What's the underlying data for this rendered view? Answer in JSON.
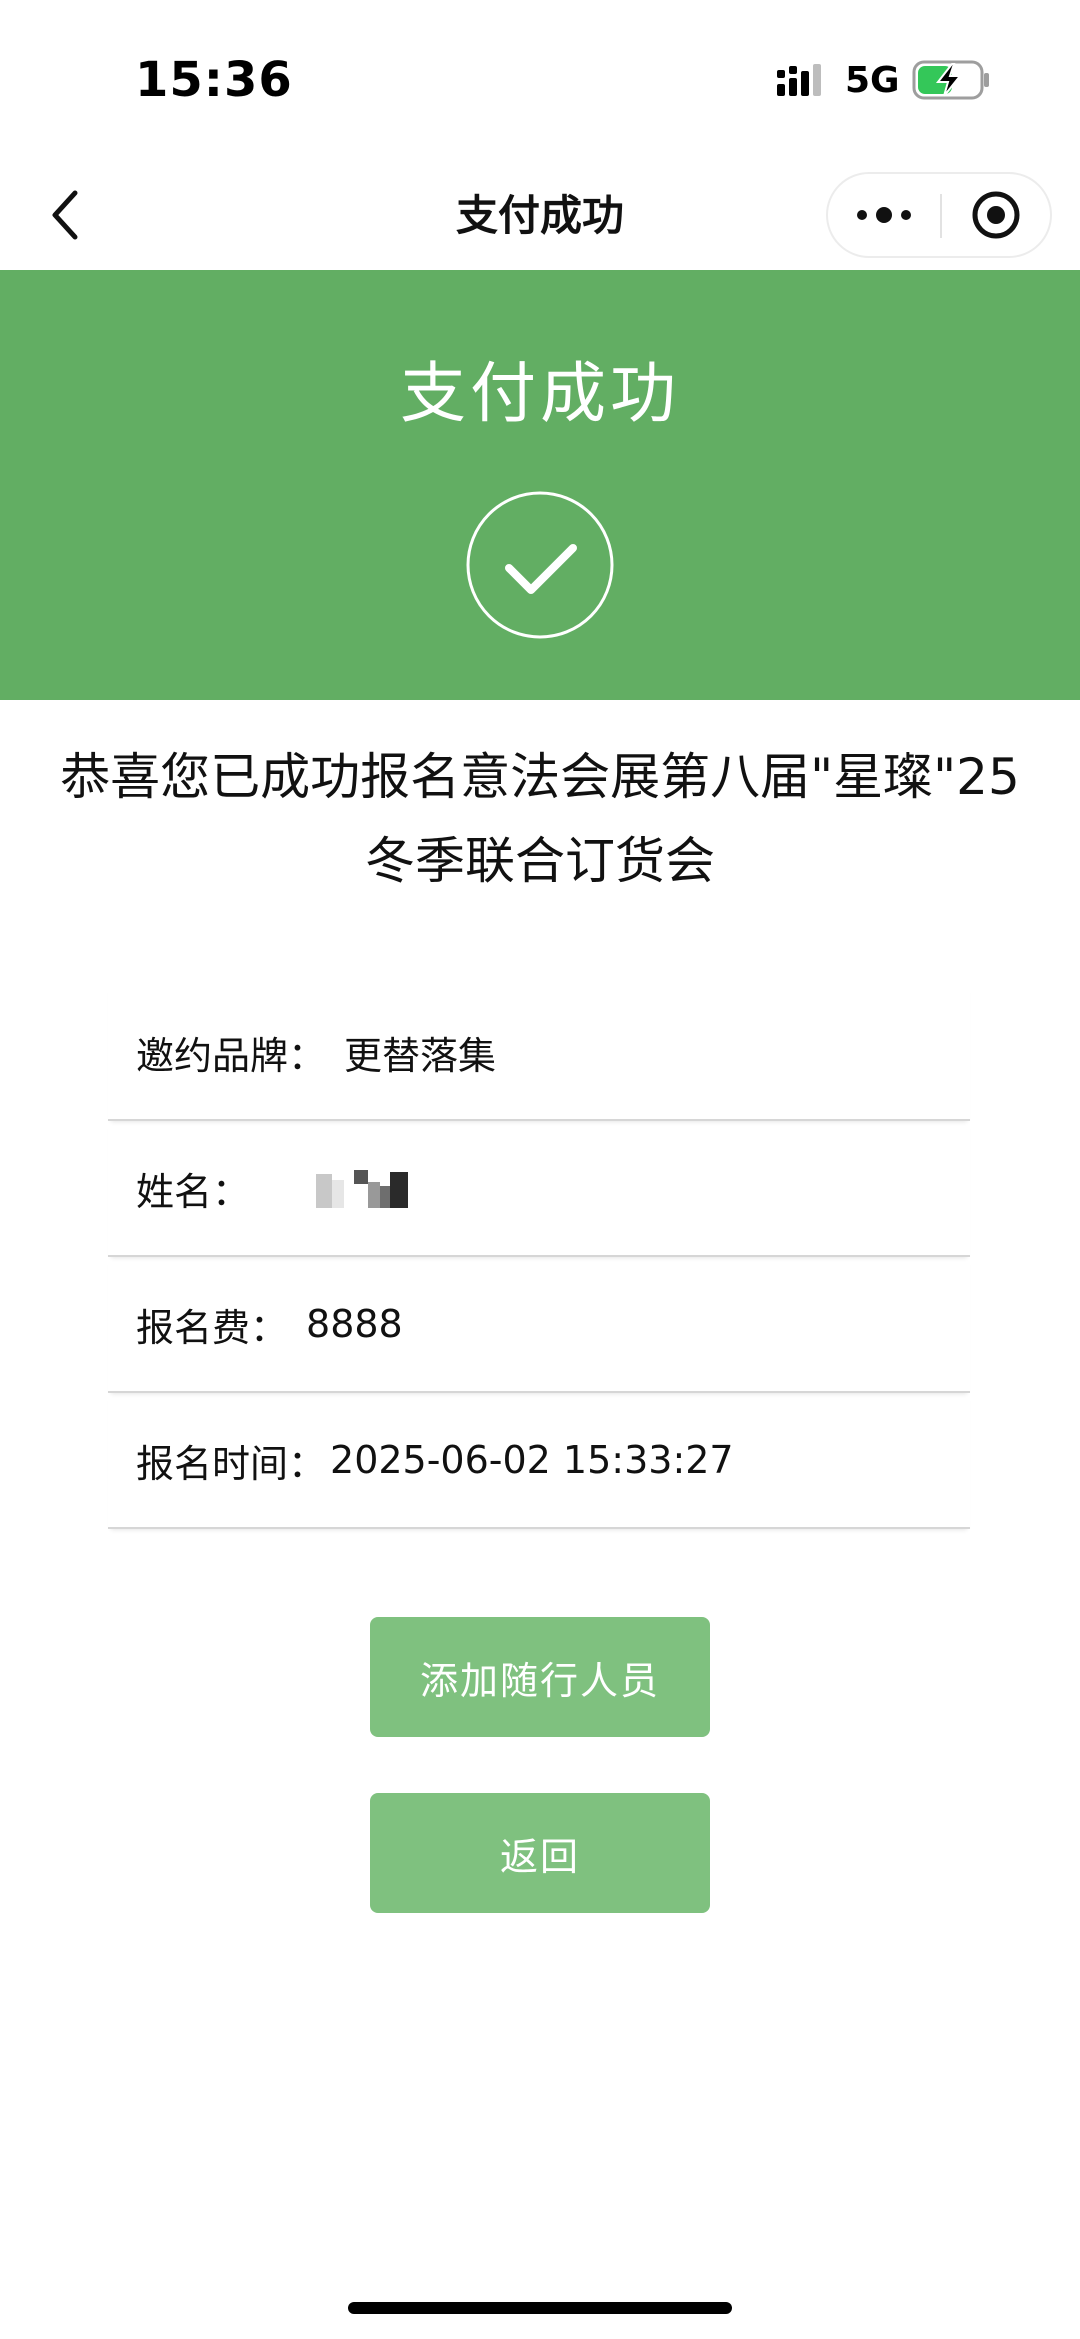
{
  "status_bar": {
    "time": "15:36",
    "network": "5G",
    "icons": [
      "signal-icon",
      "battery-charging-icon"
    ]
  },
  "nav": {
    "title": "支付成功",
    "icons": [
      "back-chevron-icon",
      "more-dots-icon",
      "close-target-icon"
    ]
  },
  "banner": {
    "title": "支付成功",
    "icon": "check-circle-icon",
    "color": "#62ae63"
  },
  "message": {
    "line1": "恭喜您已成功报名意法会展第八届\"星璨\"25",
    "line2": "冬季联合订货会"
  },
  "info": {
    "brand_label": "邀约品牌：",
    "brand_value": "更替落集",
    "name_label": "姓名：",
    "fee_label": "报名费：",
    "fee_value": "8888",
    "time_label": "报名时间：",
    "time_value": "2025-06-02 15:33:27"
  },
  "buttons": {
    "add_companion": "添加随行人员",
    "back": "返回",
    "color": "#7fc17f"
  }
}
